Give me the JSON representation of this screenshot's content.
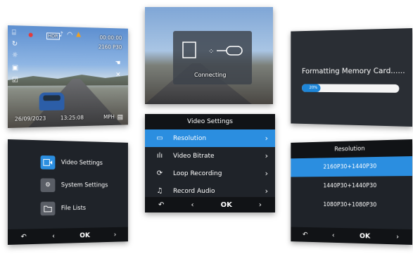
{
  "recording": {
    "time": "00:00:00",
    "resolution": "2160 P30",
    "date": "26/09/2023",
    "clock": "13:25:08",
    "speed_unit": "MPH",
    "hdr": "HDR"
  },
  "connecting": {
    "label": "Connecting"
  },
  "formatting": {
    "title": "Formatting Memory Card......",
    "progress_label": "20%",
    "progress": 0.2
  },
  "main_menu": {
    "items": [
      {
        "label": "Video Settings",
        "icon": "video-camera-icon"
      },
      {
        "label": "System Settings",
        "icon": "gear-icon"
      },
      {
        "label": "File Lists",
        "icon": "folder-icon"
      }
    ]
  },
  "video_settings": {
    "title": "Video Settings",
    "items": [
      {
        "label": "Resolution",
        "icon": "screen-icon"
      },
      {
        "label": "Video Bitrate",
        "icon": "bitrate-icon"
      },
      {
        "label": "Loop Recording",
        "icon": "loop-icon"
      },
      {
        "label": "Record Audio",
        "icon": "bell-icon"
      }
    ]
  },
  "resolution": {
    "title": "Resolution",
    "options": [
      "2160P30+1440P30",
      "1440P30+1440P30",
      "1080P30+1080P30"
    ]
  },
  "nav": {
    "back": "↶",
    "left": "‹",
    "ok": "OK",
    "right": "›"
  },
  "colors": {
    "accent": "#2b8ee0",
    "panel": "#1f2329"
  }
}
